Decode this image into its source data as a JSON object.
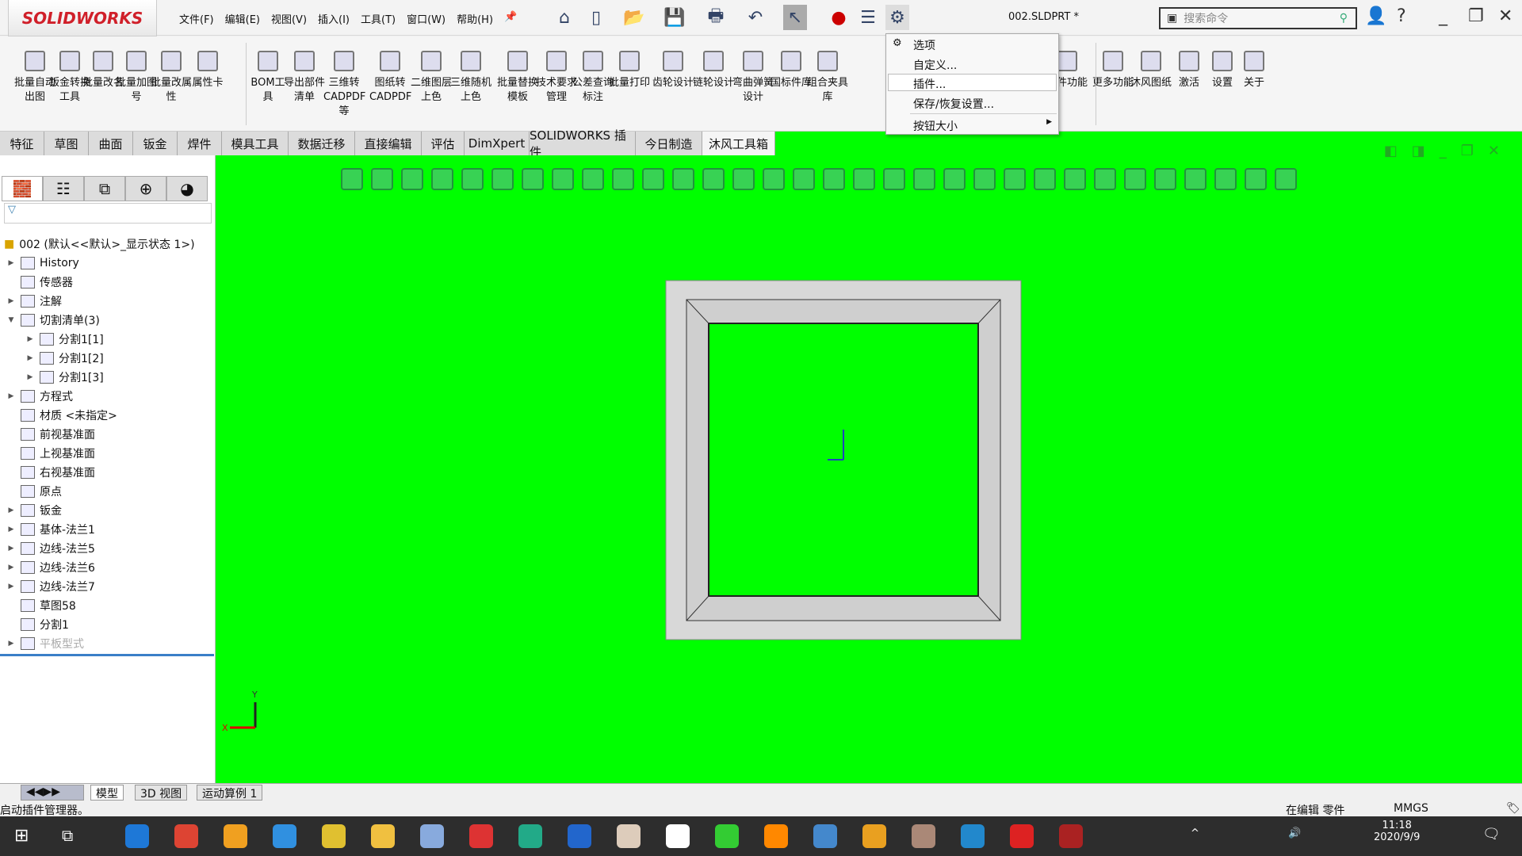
{
  "app": {
    "logo": "SOLIDWORKS",
    "doc_title": "002.SLDPRT *"
  },
  "menu": [
    "文件(F)",
    "编辑(E)",
    "视图(V)",
    "插入(I)",
    "工具(T)",
    "窗口(W)",
    "帮助(H)"
  ],
  "search": {
    "placeholder": "搜索命令"
  },
  "ribbon": [
    {
      "label": "批量自动出图"
    },
    {
      "label": "钣金转换工具"
    },
    {
      "label": "批量改名"
    },
    {
      "label": "批量加图号"
    },
    {
      "label": "批量改属性"
    },
    {
      "label": "属性卡"
    },
    {
      "label": "BOM工具"
    },
    {
      "label": "导出部件清单"
    },
    {
      "label": "三维转CADPDF等"
    },
    {
      "label": "图纸转CADPDF"
    },
    {
      "label": "二维图层上色"
    },
    {
      "label": "三维随机上色"
    },
    {
      "label": "批量替换模板"
    },
    {
      "label": "技术要求管理"
    },
    {
      "label": "公差查询标注"
    },
    {
      "label": "批量打印"
    },
    {
      "label": "齿轮设计"
    },
    {
      "label": "链轮设计"
    },
    {
      "label": "弯曲弹簧设计"
    },
    {
      "label": "国标件库"
    },
    {
      "label": "组合夹具库"
    },
    {
      "label": "焊件功能"
    },
    {
      "label": "更多功能"
    },
    {
      "label": "沐风图纸"
    },
    {
      "label": "激活"
    },
    {
      "label": "设置"
    },
    {
      "label": "关于"
    }
  ],
  "tabs": [
    "特征",
    "草图",
    "曲面",
    "钣金",
    "焊件",
    "模具工具",
    "数据迁移",
    "直接编辑",
    "评估",
    "DimXpert",
    "SOLIDWORKS 插件",
    "今日制造",
    "沐风工具箱"
  ],
  "active_tab": "沐风工具箱",
  "dropdown": [
    "选项",
    "自定义...",
    "插件...",
    "保存/恢复设置...",
    "按钮大小"
  ],
  "tree": {
    "root": "002  (默认<<默认>_显示状态 1>)",
    "items": [
      {
        "label": "History",
        "expand": true,
        "indent": 0
      },
      {
        "label": "传感器",
        "expand": false,
        "indent": 0
      },
      {
        "label": "注解",
        "expand": true,
        "indent": 0
      },
      {
        "label": "切割清单(3)",
        "expand": true,
        "indent": 0
      },
      {
        "label": "分割1[1]",
        "expand": true,
        "indent": 1
      },
      {
        "label": "分割1[2]",
        "expand": true,
        "indent": 1
      },
      {
        "label": "分割1[3]",
        "expand": true,
        "indent": 1
      },
      {
        "label": "方程式",
        "expand": true,
        "indent": 0
      },
      {
        "label": "材质 <未指定>",
        "expand": false,
        "indent": 0
      },
      {
        "label": "前视基准面",
        "expand": false,
        "indent": 0
      },
      {
        "label": "上视基准面",
        "expand": false,
        "indent": 0
      },
      {
        "label": "右视基准面",
        "expand": false,
        "indent": 0
      },
      {
        "label": "原点",
        "expand": false,
        "indent": 0
      },
      {
        "label": "钣金",
        "expand": true,
        "indent": 0
      },
      {
        "label": "基体-法兰1",
        "expand": true,
        "indent": 0
      },
      {
        "label": "边线-法兰5",
        "expand": true,
        "indent": 0
      },
      {
        "label": "边线-法兰6",
        "expand": true,
        "indent": 0
      },
      {
        "label": "边线-法兰7",
        "expand": true,
        "indent": 0
      },
      {
        "label": "草图58",
        "expand": false,
        "indent": 0
      },
      {
        "label": "分割1",
        "expand": false,
        "indent": 0
      },
      {
        "label": "平板型式",
        "expand": true,
        "indent": 0
      }
    ]
  },
  "bottom_tabs": [
    "模型",
    "3D 视图",
    "运动算例 1"
  ],
  "status": {
    "message": "启动插件管理器。",
    "mode": "在编辑 零件",
    "units": "MMGS"
  },
  "axes": {
    "x": "X",
    "y": "Y"
  },
  "clock": {
    "time": "11:18",
    "date": "2020/9/9"
  },
  "colors": {
    "viewport": "#00ff00",
    "accent": "#d0202a"
  }
}
